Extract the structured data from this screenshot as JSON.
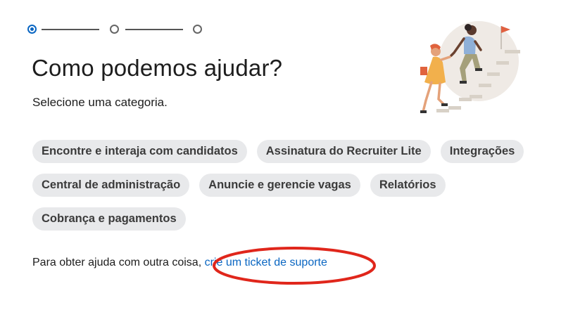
{
  "stepper": {
    "steps": 3,
    "current": 1
  },
  "header": {
    "title": "Como podemos ajudar?",
    "subtitle": "Selecione uma categoria."
  },
  "categories": [
    "Encontre e interaja com candidatos",
    "Assinatura do Recruiter Lite",
    "Integrações",
    "Central de administração",
    "Anuncie e gerencie vagas",
    "Relatórios",
    "Cobrança e pagamentos"
  ],
  "help": {
    "prefix": "Para obter ajuda com outra coisa,",
    "link_label": "crie um ticket de suporte"
  },
  "colors": {
    "accent": "#0a66c2",
    "chip_bg": "#e8e9eb",
    "annotation": "#e0261b"
  }
}
